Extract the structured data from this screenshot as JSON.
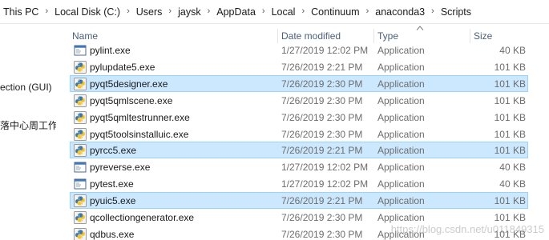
{
  "breadcrumb": [
    "This PC",
    "Local Disk (C:)",
    "Users",
    "jaysk",
    "AppData",
    "Local",
    "Continuum",
    "anaconda3",
    "Scripts"
  ],
  "nav": {
    "items": [
      "ection (GUI)",
      "落中心周工作."
    ]
  },
  "columns": {
    "name": "Name",
    "date": "Date modified",
    "type": "Type",
    "size": "Size",
    "sorted_by": "type"
  },
  "files": [
    {
      "name": "pylint.exe",
      "date": "1/27/2019 12:02 PM",
      "type": "Application",
      "size": "40 KB",
      "icon": "exe-window-icon",
      "selected": false
    },
    {
      "name": "pylupdate5.exe",
      "date": "7/26/2019 2:21 PM",
      "type": "Application",
      "size": "101 KB",
      "icon": "python-icon",
      "selected": false
    },
    {
      "name": "pyqt5designer.exe",
      "date": "7/26/2019 2:30 PM",
      "type": "Application",
      "size": "101 KB",
      "icon": "python-icon",
      "selected": true
    },
    {
      "name": "pyqt5qmlscene.exe",
      "date": "7/26/2019 2:30 PM",
      "type": "Application",
      "size": "101 KB",
      "icon": "python-icon",
      "selected": false
    },
    {
      "name": "pyqt5qmltestrunner.exe",
      "date": "7/26/2019 2:30 PM",
      "type": "Application",
      "size": "101 KB",
      "icon": "python-icon",
      "selected": false
    },
    {
      "name": "pyqt5toolsinstalluic.exe",
      "date": "7/26/2019 2:30 PM",
      "type": "Application",
      "size": "101 KB",
      "icon": "python-icon",
      "selected": false
    },
    {
      "name": "pyrcc5.exe",
      "date": "7/26/2019 2:21 PM",
      "type": "Application",
      "size": "101 KB",
      "icon": "python-icon",
      "selected": true
    },
    {
      "name": "pyreverse.exe",
      "date": "1/27/2019 12:02 PM",
      "type": "Application",
      "size": "40 KB",
      "icon": "exe-window-icon",
      "selected": false
    },
    {
      "name": "pytest.exe",
      "date": "1/27/2019 12:02 PM",
      "type": "Application",
      "size": "40 KB",
      "icon": "exe-window-icon",
      "selected": false
    },
    {
      "name": "pyuic5.exe",
      "date": "7/26/2019 2:21 PM",
      "type": "Application",
      "size": "101 KB",
      "icon": "python-icon",
      "selected": true
    },
    {
      "name": "qcollectiongenerator.exe",
      "date": "7/26/2019 2:30 PM",
      "type": "Application",
      "size": "101 KB",
      "icon": "python-icon",
      "selected": false
    },
    {
      "name": "qdbus.exe",
      "date": "7/26/2019 2:30 PM",
      "type": "Application",
      "size": "101 KB",
      "icon": "python-icon",
      "selected": false
    }
  ],
  "watermark": "https://blog.csdn.net/u011849315",
  "colors": {
    "selection_bg": "#cce8ff",
    "selection_border": "#99d1ff",
    "header_text": "#4c607a",
    "meta_text": "#6d6d6d"
  }
}
